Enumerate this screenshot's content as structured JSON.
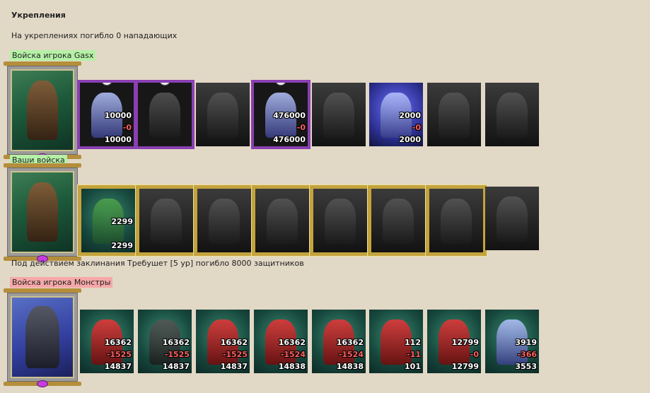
{
  "title": "Укрепления",
  "summary": "На укреплениях погибло 0 нападающих",
  "groups": [
    {
      "label": "Войска игрока Gasx"
    },
    {
      "label": "Ваши войска"
    },
    {
      "label": "Войска игрока Монстры"
    }
  ],
  "spell_line": "Под действием заклинания Требушет [5 ур] погибло 8000 защитников",
  "attacker_units": [
    {
      "top": "10000",
      "mid": "-0",
      "bot": "10000"
    },
    {
      "top": "476000",
      "mid": "-0",
      "bot": "476000"
    },
    {
      "top": "2000",
      "mid": "-0",
      "bot": "2000"
    }
  ],
  "your_units": [
    {
      "top": "2299",
      "bot": "2299"
    }
  ],
  "monster_units": [
    {
      "top": "16362",
      "mid": "-1525",
      "bot": "14837"
    },
    {
      "top": "16362",
      "mid": "-1525",
      "bot": "14837"
    },
    {
      "top": "16362",
      "mid": "-1525",
      "bot": "14837"
    },
    {
      "top": "16362",
      "mid": "-1524",
      "bot": "14838"
    },
    {
      "top": "16362",
      "mid": "-1524",
      "bot": "14838"
    },
    {
      "top": "112",
      "mid": "-11",
      "bot": "101"
    },
    {
      "top": "12799",
      "mid": "-0",
      "bot": "12799"
    },
    {
      "top": "3919",
      "mid": "-366",
      "bot": "3553"
    }
  ]
}
